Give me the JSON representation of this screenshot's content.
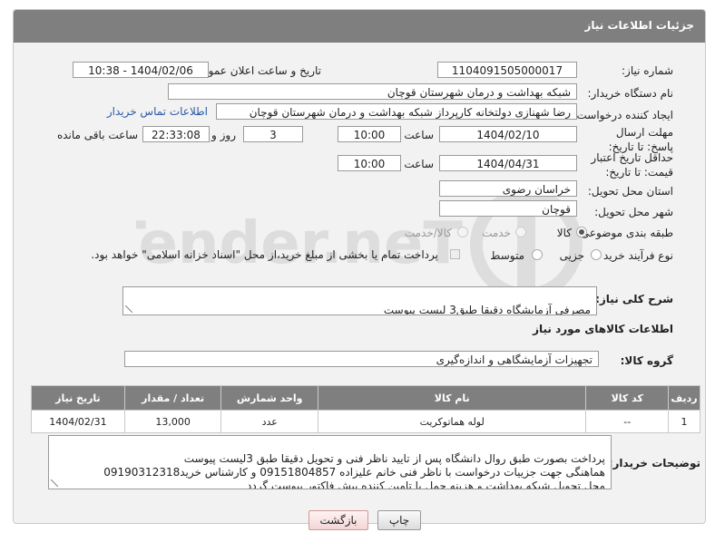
{
  "header": {
    "title": "جزئیات اطلاعات نیاز"
  },
  "fields": {
    "need_number_label": "شماره نیاز:",
    "need_number": "1104091505000017",
    "announce_label": "تاریخ و ساعت اعلان عمومی:",
    "announce_value": "1404/02/06 - 10:38",
    "buyer_org_label": "نام دستگاه خریدار:",
    "buyer_org": "شبکه بهداشت و درمان شهرستان قوچان",
    "requester_label": "ایجاد کننده درخواست:",
    "requester": "رضا شهنازی دولتخانه کارپرداز شبکه بهداشت و درمان شهرستان قوچان",
    "contact_link": "اطلاعات تماس خریدار",
    "deadline_label": "مهلت ارسال پاسخ: تا تاریخ:",
    "deadline_date": "1404/02/10",
    "time_label": "ساعت",
    "deadline_time": "10:00",
    "days_value": "3",
    "days_label": "روز و",
    "remaining_time": "22:33:08",
    "remaining_label": "ساعت باقی مانده",
    "price_validity_label": "حداقل تاریخ اعتبار قیمت: تا تاریخ:",
    "price_date": "1404/04/31",
    "price_time": "10:00",
    "province_label": "استان محل تحویل:",
    "province": "خراسان رضوی",
    "city_label": "شهر محل تحویل:",
    "city": "قوچان",
    "category_label": "طبقه بندی موضوعی:",
    "category_options": [
      "کالا",
      "خدمت",
      "کالا/خدمت"
    ],
    "process_label": "نوع فرآیند خرید :",
    "process_options": [
      "جزیی",
      "متوسط"
    ],
    "payment_note": "پرداخت تمام یا بخشی از مبلغ خرید،از محل \"اسناد خزانه اسلامی\" خواهد بود."
  },
  "description": {
    "label": "شرح کلی نیاز:",
    "value": "مصرفی آزمایشگاه دقیقا طبق3 لیست پیوست"
  },
  "goods": {
    "section_title": "اطلاعات کالاهای مورد نیاز",
    "group_label": "گروه کالا:",
    "group_value": "تجهیزات آزمایشگاهی و اندازه‌گیری",
    "columns": [
      "ردیف",
      "کد کالا",
      "نام کالا",
      "واحد شمارش",
      "تعداد / مقدار",
      "تاریخ نیاز"
    ],
    "rows": [
      {
        "row": "1",
        "code": "--",
        "name": "لوله هماتوکریت",
        "unit": "عدد",
        "qty": "13,000",
        "date": "1404/02/31"
      }
    ]
  },
  "buyer_notes": {
    "label": "توضیحات خریدار:",
    "value": "پرداخت بصورت طبق روال دانشگاه پس از تایید ناظر فنی و تحویل دقیقا طبق 3لیست پیوست\nهماهنگی جهت جزییات درخواست با ناظر فنی خانم علیزاده 09151804857 و کارشناس خرید09190312318\nمحل تحویل شبکه بهداشت و هزینه حمل با تامین کننده پیش فاکتور پیوست گردد"
  },
  "buttons": {
    "print": "چاپ",
    "back": "بازگشت"
  },
  "watermark": {
    "text": "AriaTender.neT"
  }
}
